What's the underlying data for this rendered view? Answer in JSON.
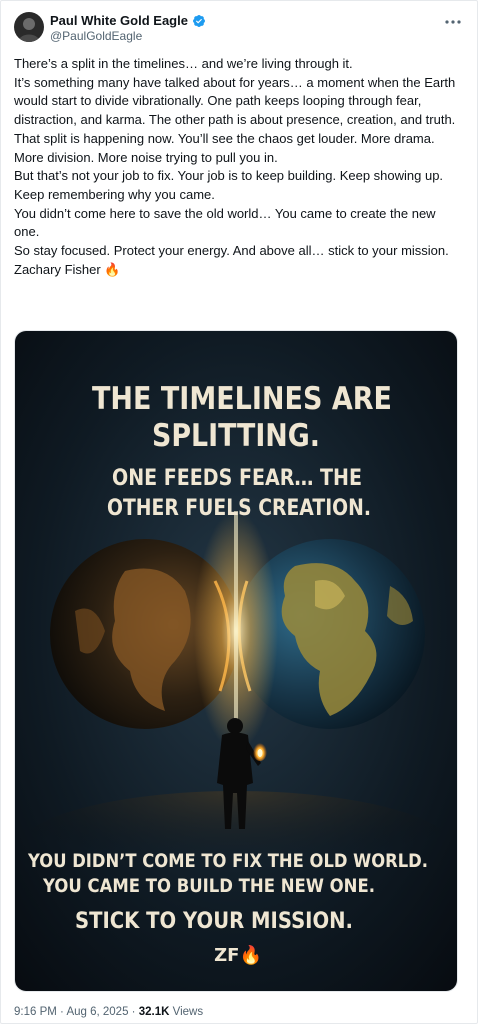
{
  "author": {
    "display_name": "Paul White Gold Eagle",
    "handle": "@PaulGoldEagle"
  },
  "post": {
    "lines": [
      "There’s a split in the timelines… and we’re living through it.",
      "It’s something many have talked about for years…  a moment when the Earth would start to divide vibrationally. One path keeps looping through fear, distraction, and karma. The other path is about presence, creation, and truth.",
      "That split is happening now. You’ll see the chaos get louder. More drama. More division. More noise trying to pull you in.",
      "But that’s not your job to fix. Your job is to keep building. Keep showing up. Keep remembering why you came.",
      "You didn’t come here to save the old world… You came to create the new one.",
      "So stay focused. Protect your energy. And above all… stick to your mission.",
      "Zachary Fisher 🔥"
    ]
  },
  "image": {
    "headline_1": "THE TIMELINES ARE",
    "headline_2": "SPLITTING.",
    "sub_1": "ONE FEEDS FEAR… THE",
    "sub_2": "OTHER FUELS CREATION.",
    "bottom_1": "YOU DIDN’T COME TO FIX THE OLD WORLD.",
    "bottom_2": "YOU CAME TO BUILD THE NEW ONE.",
    "bottom_3": "STICK TO YOUR MISSION.",
    "signature": "ZF🔥"
  },
  "meta": {
    "time": "9:16 PM",
    "sep": "·",
    "date": "Aug 6, 2025",
    "views_count": "32.1K",
    "views_label": "Views"
  },
  "colors": {
    "accent": "#1d9bf0",
    "text": "#0f1419",
    "secondary": "#536471"
  }
}
